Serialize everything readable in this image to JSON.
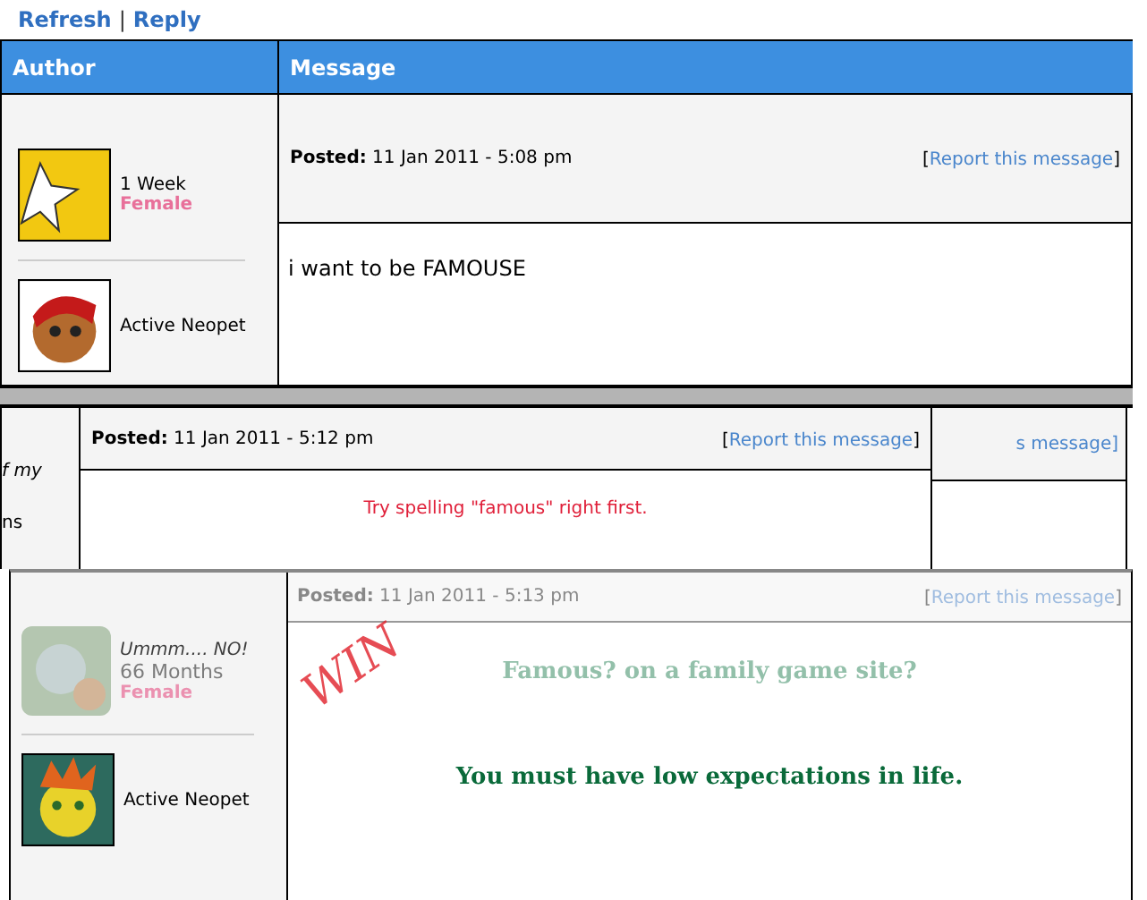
{
  "top_links": [
    {
      "label": "Refresh"
    },
    {
      "label": "Reply"
    }
  ],
  "link_separator": "|",
  "table": {
    "columns": [
      "Author",
      "Message"
    ]
  },
  "post_1": {
    "tenure": "1 Week",
    "gender": "Female",
    "pet_status": "Active Neopet",
    "posted_label": "Posted:",
    "posted_time": "11 Jan 2011 - 5:08 pm",
    "report_brackets": [
      "[",
      "]"
    ],
    "report_link": "Report this message",
    "message": "i want to be FAMOUSE"
  },
  "post_2": {
    "left_fragments": [
      "f my",
      "ns"
    ],
    "posted_label": "Posted:",
    "posted_time": "11 Jan 2011 - 5:12 pm",
    "report_brackets": [
      "[",
      "]"
    ],
    "report_link": "Report this message",
    "message": "Try spelling \"famous\" right first.",
    "right_fragment": "s message]"
  },
  "post_3": {
    "signature": "Ummm.... NO!",
    "tenure": "66 Months",
    "gender": "Female",
    "pet_status": "Active Neopet",
    "posted_label": "Posted:",
    "posted_time": "11 Jan 2011 - 5:13 pm",
    "report_brackets": [
      "[",
      "]"
    ],
    "report_link": "Report this message",
    "lines": [
      "Famous? on a family game site?",
      "You must have low expectations in life."
    ],
    "annotation": "WIN"
  }
}
